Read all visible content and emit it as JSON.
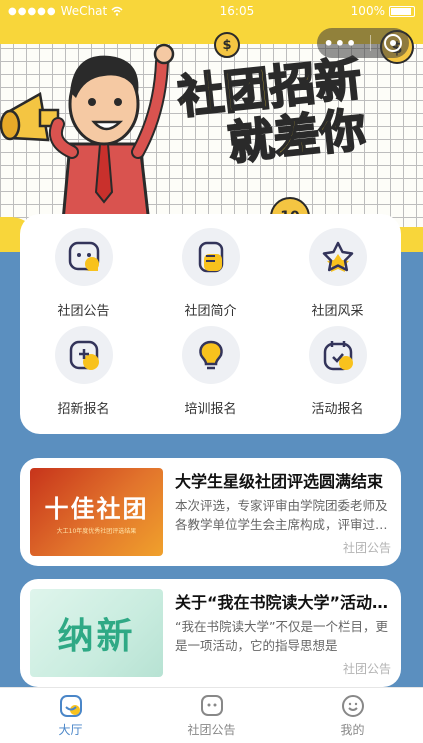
{
  "status_bar": {
    "carrier": "WeChat",
    "time": "16:05",
    "battery": "100%"
  },
  "banner": {
    "slogan_line1": "社团招新",
    "slogan_line2": "就差你",
    "coin_symbol": "$",
    "coin_value": "10"
  },
  "capsule": {
    "more": "•••"
  },
  "menu": {
    "items": [
      {
        "label": "社团公告",
        "icon": "chat-bubble-icon"
      },
      {
        "label": "社团简介",
        "icon": "document-icon"
      },
      {
        "label": "社团风采",
        "icon": "star-icon"
      },
      {
        "label": "招新报名",
        "icon": "add-box-icon"
      },
      {
        "label": "培训报名",
        "icon": "lightbulb-icon"
      },
      {
        "label": "活动报名",
        "icon": "calendar-check-icon"
      }
    ]
  },
  "news": [
    {
      "title": "大学生星级社团评选圆满结束",
      "desc": "本次评选，专家评审由学院团委老师及各教学单位学生会主席构成，评审过程公正公开",
      "tag": "社团公告",
      "thumb_title": "十佳社团",
      "thumb_sub": "大工10年度优秀社团评选结果"
    },
    {
      "title": "关于“我在书院读大学”活动介绍",
      "desc": "“我在书院读大学”不仅是一个栏目，更是一项活动，它的指导思想是",
      "tag": "社团公告",
      "thumb_title": "纳新"
    }
  ],
  "tabs": [
    {
      "label": "大厅",
      "active": true
    },
    {
      "label": "社团公告",
      "active": false
    },
    {
      "label": "我的",
      "active": false
    }
  ],
  "colors": {
    "accent_yellow": "#f8d63a",
    "background_blue": "#5b8fbf",
    "tab_active": "#4a86c8"
  }
}
